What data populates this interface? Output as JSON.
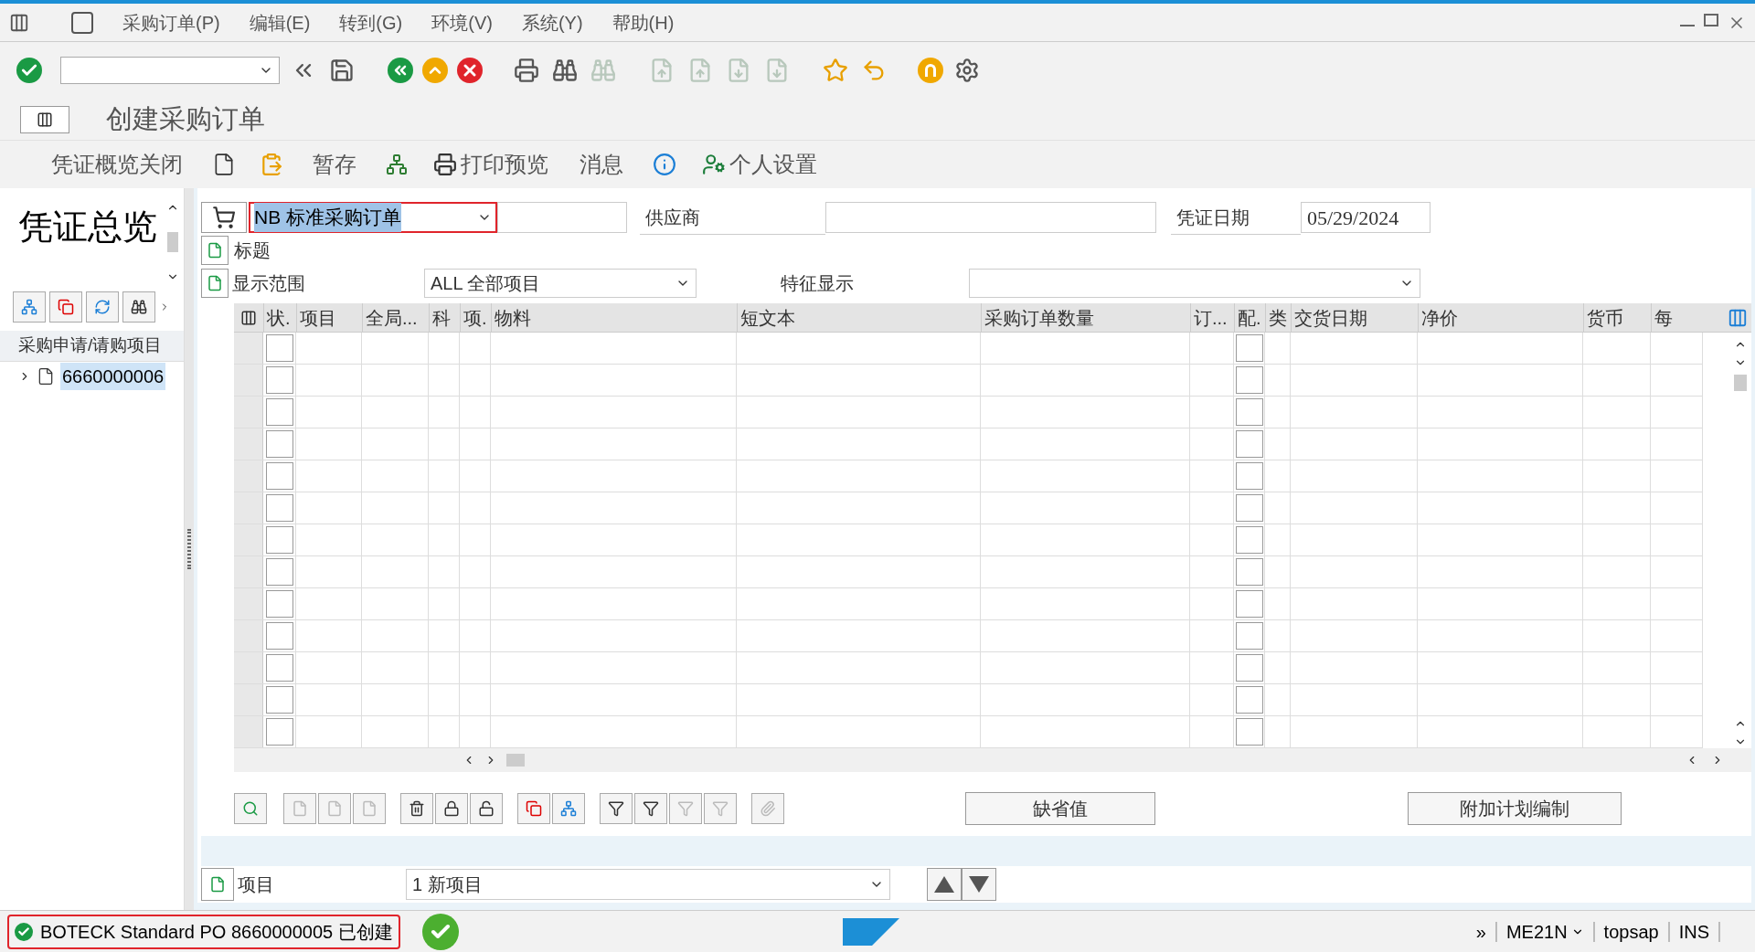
{
  "menu": [
    "采购订单(P)",
    "编辑(E)",
    "转到(G)",
    "环境(V)",
    "系统(Y)",
    "帮助(H)"
  ],
  "title": "创建采购订单",
  "app_toolbar": [
    {
      "kind": "text",
      "label": "凭证概览关闭"
    },
    {
      "kind": "icon"
    },
    {
      "kind": "icon"
    },
    {
      "kind": "text",
      "label": "暂存"
    },
    {
      "kind": "icon"
    },
    {
      "kind": "iconlabel",
      "label": "打印预览"
    },
    {
      "kind": "text",
      "label": "消息"
    },
    {
      "kind": "icon"
    },
    {
      "kind": "iconlabel",
      "label": "个人设置"
    }
  ],
  "sidebar": {
    "title": "凭证总览",
    "section": "采购申请/请购项目",
    "items": [
      {
        "label": "6660000006",
        "expanded": false,
        "selected": true
      }
    ]
  },
  "header": {
    "order_type": "NB 标准采购订单",
    "vendor_label": "供应商",
    "date_label": "凭证日期",
    "date": "05/29/2024",
    "heading_label": "标题",
    "range_label": "显示范围",
    "range": "ALL 全部项目",
    "feature_label": "特征显示"
  },
  "table": {
    "columns": [
      {
        "label": "状.",
        "kind": "box"
      },
      {
        "label": "项目",
        "kind": "text"
      },
      {
        "label": "全局...",
        "kind": "text"
      },
      {
        "label": "科",
        "kind": "text"
      },
      {
        "label": "项.",
        "kind": "text"
      },
      {
        "label": "物料",
        "kind": "text"
      },
      {
        "label": "短文本",
        "kind": "text"
      },
      {
        "label": "采购订单数量",
        "kind": "text"
      },
      {
        "label": "订...",
        "kind": "text"
      },
      {
        "label": "配.",
        "kind": "box"
      },
      {
        "label": "类",
        "kind": "text"
      },
      {
        "label": "交货日期",
        "kind": "text"
      },
      {
        "label": "净价",
        "kind": "text"
      },
      {
        "label": "货币",
        "kind": "text"
      },
      {
        "label": "每",
        "kind": "text"
      }
    ]
  },
  "buttons": [
    "缺省值",
    "附加计划编制"
  ],
  "item": {
    "label": "项目",
    "value": "1 新项目"
  },
  "status_bar": {
    "message": "BOTECK Standard PO 8660000005 已创建",
    "more": "»",
    "transaction": "ME21N",
    "server": "topsap",
    "mode": "INS"
  }
}
